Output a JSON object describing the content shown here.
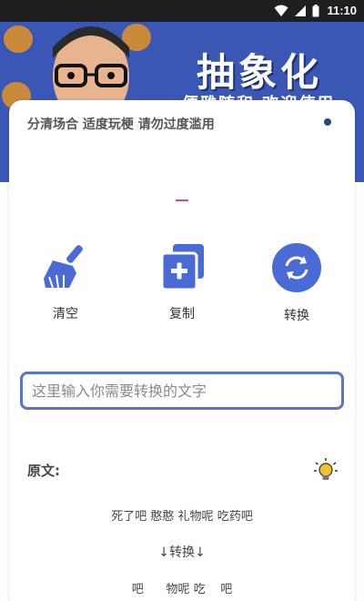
{
  "status_bar": {
    "time": "11:10",
    "icons": [
      "wifi-icon",
      "signal-icon",
      "battery-icon"
    ]
  },
  "banner": {
    "title": "抽象化",
    "slogan": "便雅随和 欢迎使用"
  },
  "notice": {
    "text": "分清场合 适度玩梗 请勿过度滥用"
  },
  "actions": {
    "clear": {
      "label": "清空",
      "icon": "broom-icon"
    },
    "copy": {
      "label": "复制",
      "icon": "copy-icon"
    },
    "convert": {
      "label": "转换",
      "icon": "refresh-icon"
    }
  },
  "input": {
    "placeholder": "这里输入你需要转换的文字",
    "value": ""
  },
  "original": {
    "label": "原文:",
    "text": "死了吧 憨憨 礼物呢 吃药吧"
  },
  "arrow_label": "↓转换↓",
  "result_text": "吧      物呢 吃    吧",
  "colors": {
    "accent": "#5a73cc",
    "banner": "#3b57b5",
    "pink_mark": "#e0457b",
    "bulb": "#f2c12e"
  }
}
